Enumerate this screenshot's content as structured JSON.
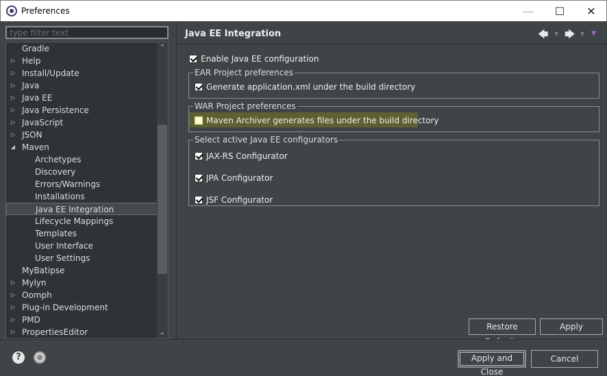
{
  "window": {
    "title": "Preferences",
    "minimize": "—",
    "maximize": "☐",
    "close": "✕"
  },
  "left": {
    "filter_placeholder": "type filter text",
    "tree": [
      {
        "label": "Gradle",
        "expander": "",
        "level": 0
      },
      {
        "label": "Help",
        "expander": "▷",
        "level": 0
      },
      {
        "label": "Install/Update",
        "expander": "▷",
        "level": 0
      },
      {
        "label": "Java",
        "expander": "▷",
        "level": 0
      },
      {
        "label": "Java EE",
        "expander": "▷",
        "level": 0
      },
      {
        "label": "Java Persistence",
        "expander": "▷",
        "level": 0
      },
      {
        "label": "JavaScript",
        "expander": "▷",
        "level": 0
      },
      {
        "label": "JSON",
        "expander": "▷",
        "level": 0
      },
      {
        "label": "Maven",
        "expander": "◢",
        "level": 0
      },
      {
        "label": "Archetypes",
        "expander": "",
        "level": 1
      },
      {
        "label": "Discovery",
        "expander": "",
        "level": 1
      },
      {
        "label": "Errors/Warnings",
        "expander": "",
        "level": 1
      },
      {
        "label": "Installations",
        "expander": "",
        "level": 1
      },
      {
        "label": "Java EE Integration",
        "expander": "",
        "level": 1,
        "selected": true
      },
      {
        "label": "Lifecycle Mappings",
        "expander": "",
        "level": 1
      },
      {
        "label": "Templates",
        "expander": "",
        "level": 1
      },
      {
        "label": "User Interface",
        "expander": "",
        "level": 1
      },
      {
        "label": "User Settings",
        "expander": "",
        "level": 1
      },
      {
        "label": "MyBatipse",
        "expander": "",
        "level": 0
      },
      {
        "label": "Mylyn",
        "expander": "▷",
        "level": 0
      },
      {
        "label": "Oomph",
        "expander": "▷",
        "level": 0
      },
      {
        "label": "Plug-in Development",
        "expander": "▷",
        "level": 0
      },
      {
        "label": "PMD",
        "expander": "▷",
        "level": 0
      },
      {
        "label": "PropertiesEditor",
        "expander": "▷",
        "level": 0
      }
    ],
    "scroll_up": "⌃",
    "scroll_down": "⌄"
  },
  "page": {
    "title": "Java EE Integration",
    "nav_back": "🡄",
    "nav_forward": "🡆",
    "nav_dropdown": "▼",
    "enable_label": "Enable Java EE configuration",
    "ear_group": "EAR Project preferences",
    "ear_generate": "Generate application.xml under the build directory",
    "war_group": "WAR Project preferences",
    "war_maven_archiver": "Maven Archiver generates files under the build directory",
    "configurators_group": "Select active Java EE configurators",
    "jaxrs": "JAX-RS Configurator",
    "jpa": "JPA Configurator",
    "jsf": "JSF Configurator",
    "restore_defaults": "Restore Defaults",
    "apply": "Apply"
  },
  "footer": {
    "help": "?",
    "apply_and_close": "Apply and Close",
    "cancel": "Cancel"
  },
  "icons": [
    "eclipse-app-icon",
    "back-arrow-icon",
    "forward-arrow-icon",
    "view-menu-icon",
    "help-icon",
    "import-export-prefs-icon"
  ],
  "colors": {
    "background": "#3f4447",
    "highlight": "#5e5f32",
    "text": "#dddddd"
  }
}
